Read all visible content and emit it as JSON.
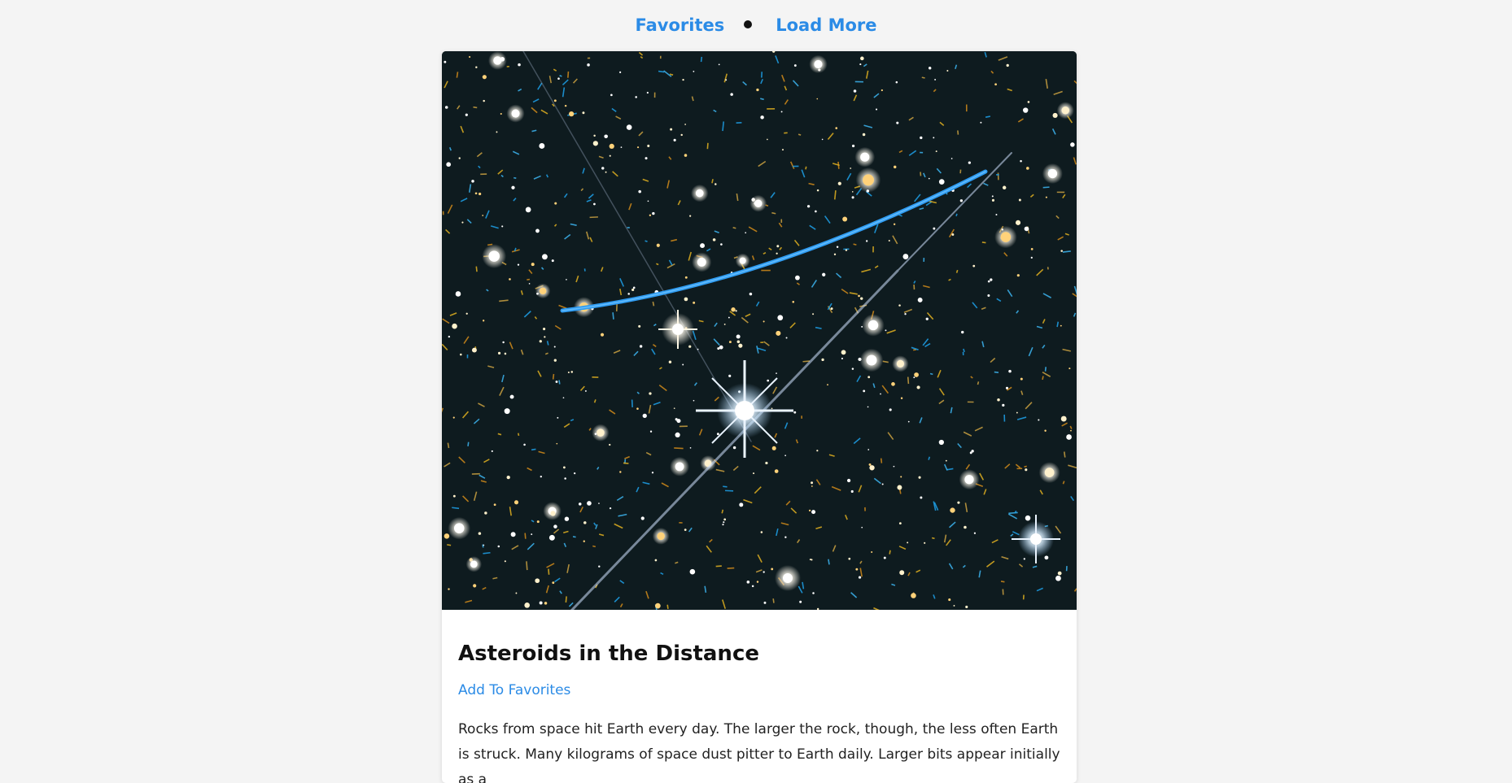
{
  "nav": {
    "favorites_label": "Favorites",
    "load_more_label": "Load More"
  },
  "card": {
    "title": "Asteroids in the Distance",
    "add_favorites_label": "Add To Favorites",
    "description": "Rocks from space hit Earth every day. The larger the rock, though, the less often Earth is struck. Many kilograms of space dust pitter to Earth daily. Larger bits appear initially as a"
  },
  "colors": {
    "link": "#2b8be6",
    "background": "#f4f4f4",
    "card": "#ffffff"
  }
}
